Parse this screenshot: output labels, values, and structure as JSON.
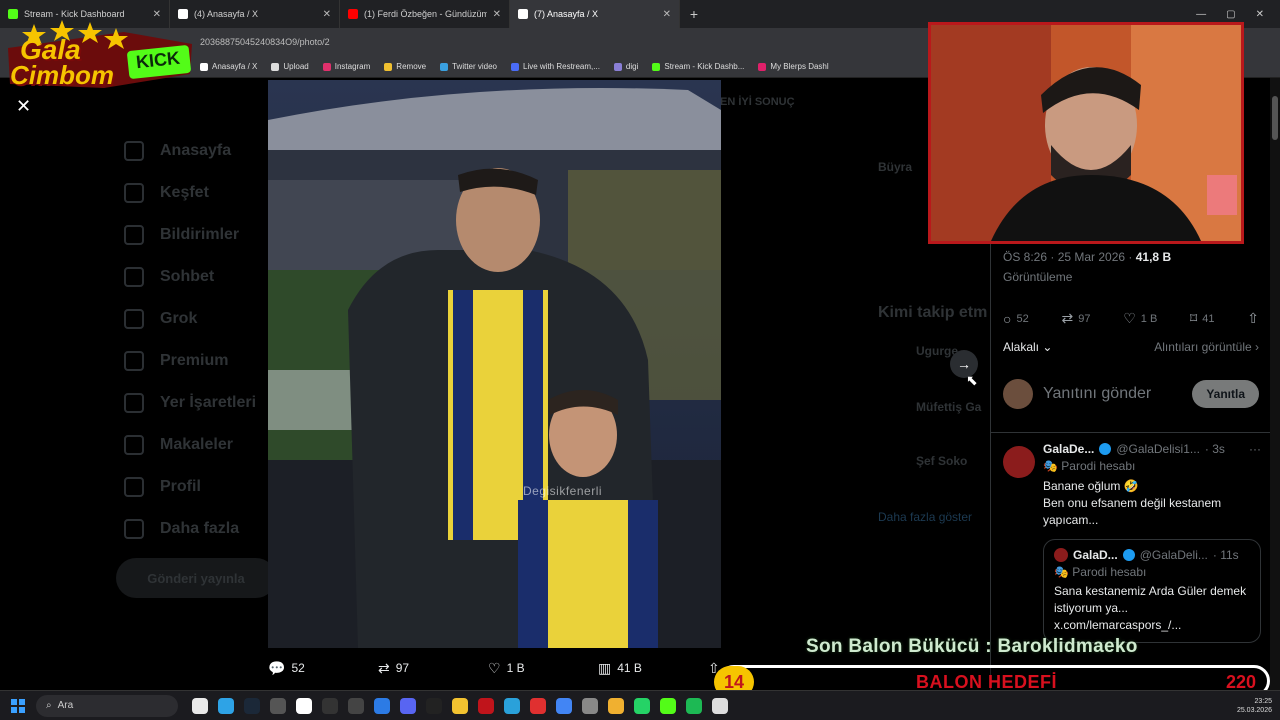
{
  "browser": {
    "tabs": [
      {
        "title": "Stream - Kick Dashboard",
        "color": "#53fc18"
      },
      {
        "title": "(4) Anasayfa / X",
        "color": "#ffffff"
      },
      {
        "title": "(1) Ferdi Özbeğen - Gündüzüm",
        "color": "#ff0000"
      },
      {
        "title": "(7) Anasayfa / X",
        "color": "#ffffff"
      }
    ],
    "url": "20368875045240834O9/photo/2",
    "bookmarks": [
      "Anasayfa / X",
      "Upload",
      "Instagram",
      "Remove",
      "Twitter video",
      "Live with Restream,...",
      "digi",
      "Stream - Kick Dashb...",
      "My Blerps Dashl"
    ]
  },
  "x_nav": [
    "Anasayfa",
    "Keşfet",
    "Bildirimler",
    "Sohbet",
    "Grok",
    "Premium",
    "Yer İşaretleri",
    "Makaleler",
    "Profil",
    "Daha fazla"
  ],
  "post_button": "Gönderi yayınla",
  "photo": {
    "watermark": "Degisikfenerli"
  },
  "photo_actions": {
    "replies": "52",
    "reposts": "97",
    "likes": "1 B",
    "views": "41 B"
  },
  "detail": {
    "time": "ÖS 8:26 · 25 Mar 2026 ·",
    "views": "41,8 B",
    "views_label": "Görüntüleme",
    "stats": {
      "replies": "52",
      "reposts": "97",
      "likes": "1 B",
      "bookmarks": "41"
    },
    "sort": "Alakalı",
    "quotes_link": "Alıntıları görüntüle",
    "reply_placeholder": "Yanıtını gönder",
    "reply_button": "Yanıtla"
  },
  "reply": {
    "name": "GalaDe...",
    "handle": "@GalaDelisi1...",
    "time": "· 3s",
    "badge": "Parodi hesabı",
    "text_line1": "Banane oğlum 🤣",
    "text_line2": "Ben onu efsanem değil kestanem yapıcam...",
    "quote": {
      "name": "GalaD...",
      "handle": "@GalaDeli...",
      "time": "· 11s",
      "badge": "Parodi hesabı",
      "text": "Sana kestanemiz Arda Güler demek istiyorum ya... x.com/lemarcaspors_/..."
    }
  },
  "dim_right": {
    "name": "Büyra",
    "who_follow": "Kimi takip etm",
    "user1": "Ugurge",
    "user2": "Müfettiş Ga",
    "user3": "Şef Soko",
    "show_more": "Daha fazla göster",
    "header": "EN İYİ SONUÇ"
  },
  "logo": {
    "line1": "Gala",
    "line2": "Cimbom",
    "badge": "KICK"
  },
  "overlay": {
    "last_user": "Son Balon Bükücü : Baroklidmaeko",
    "count": "14",
    "goal_label": "BALON HEDEFİ",
    "goal_target": "220"
  },
  "taskbar": {
    "search": "Ara",
    "time": "23:25",
    "date": "25.03.2026"
  },
  "colors": {
    "x_bg": "#000000",
    "accent_blue": "#1d9bf0",
    "kick_green": "#53fc18",
    "goal_yellow": "#f6c400",
    "goal_red": "#d8101e"
  }
}
